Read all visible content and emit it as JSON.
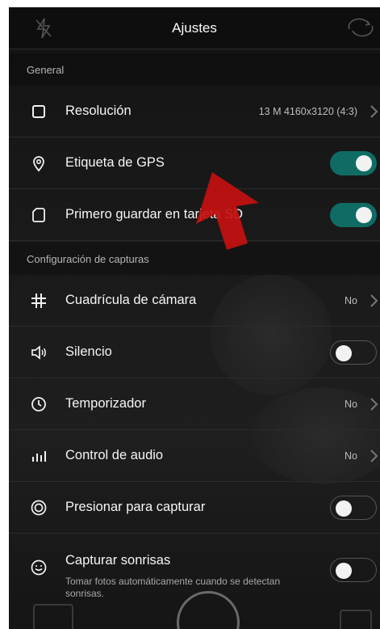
{
  "header": {
    "title": "Ajustes",
    "flash_icon": "flash-off-icon",
    "switch_icon": "switch-camera-icon"
  },
  "sections": [
    {
      "title": "General"
    },
    {
      "title": "Configuración de capturas"
    }
  ],
  "settings": {
    "resolution": {
      "label": "Resolución",
      "value": "13 M 4160x3120 (4:3)",
      "icon": "square-icon"
    },
    "gps": {
      "label": "Etiqueta de GPS",
      "icon": "location-pin-icon",
      "enabled": true
    },
    "sd": {
      "label": "Primero guardar en tarjeta SD",
      "icon": "sd-card-icon",
      "enabled": true
    },
    "grid": {
      "label": "Cuadrícula de cámara",
      "value": "No",
      "icon": "grid-icon"
    },
    "silence": {
      "label": "Silencio",
      "icon": "speaker-icon",
      "enabled": false
    },
    "timer": {
      "label": "Temporizador",
      "value": "No",
      "icon": "clock-icon"
    },
    "audio": {
      "label": "Control de audio",
      "value": "No",
      "icon": "audio-bars-icon"
    },
    "press": {
      "label": "Presionar para capturar",
      "icon": "target-icon",
      "enabled": false
    },
    "smile": {
      "label": "Capturar sonrisas",
      "sublabel": "Tomar fotos automáticamente cuando se detectan sonrisas.",
      "icon": "smile-icon",
      "enabled": false
    }
  },
  "colors": {
    "toggle_on": "#0f6c64",
    "arrow": "#c41010"
  }
}
